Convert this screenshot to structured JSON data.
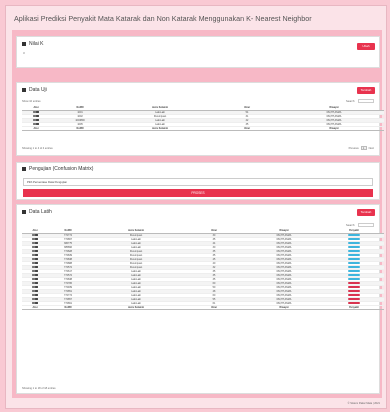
{
  "app": {
    "title": "Aplikasi Prediksi Penyakit Mata Katarak dan Non Katarak Menggunakan K- Nearest Neighbor"
  },
  "nilai_k": {
    "header": "Nilai K",
    "value": "3",
    "button": "Ubah"
  },
  "data_uji": {
    "header": "Data Uji",
    "add_button": "Tambah",
    "show_entries": "Show 10 entries",
    "search_label": "Search:",
    "columns": [
      "Aksi",
      "NoRM",
      "Jenis Kelamin",
      "Umur",
      "Riwayat"
    ],
    "rows": [
      [
        "",
        "1001",
        "Laki-Laki",
        "54",
        "DM,HT,ASMA"
      ],
      [
        "",
        "1002",
        "Perempuan",
        "31",
        "DM,HT,ASMA"
      ],
      [
        "",
        "1003890",
        "Laki-Laki",
        "42",
        "DM,HT,ASMA"
      ],
      [
        "",
        "1005",
        "Laki-Laki",
        "35",
        "DM,HT,ASMA"
      ]
    ],
    "footer_columns": [
      "Aksi",
      "NoRM",
      "Jenis Kelamin",
      "Umur",
      "Riwayat"
    ],
    "info": "Showing 1 to 4 of 4 entries",
    "prev": "Previous",
    "page": "1",
    "next": "Next"
  },
  "pengujian": {
    "header": "Pengujian (Confusion Matrix)",
    "select_value": "Pilih Persentase Data Pengujian",
    "process_button": "PROSES"
  },
  "data_latih": {
    "header": "Data Latih",
    "add_button": "Tambah",
    "search_label": "Search:",
    "columns": [
      "Aksi",
      "NoRM",
      "Jenis Kelamin",
      "Umur",
      "Riwayat",
      "Penyakit"
    ],
    "rows": [
      [
        "",
        "772774",
        "Perempuan",
        "30",
        "DM,HT,ASMA",
        "blue"
      ],
      [
        "",
        "772867",
        "Laki-Laki",
        "35",
        "DM,HT,ASMA",
        "blue"
      ],
      [
        "",
        "386775",
        "Laki-Laki",
        "44",
        "DM,HT,ASMA",
        "blue"
      ],
      [
        "",
        "385896",
        "Laki-Laki",
        "30",
        "DM,HT,ASMA",
        "blue"
      ],
      [
        "",
        "772828",
        "Perempuan",
        "35",
        "DM,HT,ASMA",
        "blue"
      ],
      [
        "",
        "772839",
        "Perempuan",
        "35",
        "DM,HT,ASMA",
        "blue"
      ],
      [
        "",
        "772838",
        "Perempuan",
        "45",
        "DM,HT,ASMA",
        "blue"
      ],
      [
        "",
        "772888",
        "Perempuan",
        "40",
        "DM,HT,ASMA",
        "blue"
      ],
      [
        "",
        "772572",
        "Perempuan",
        "32",
        "DM,HT,ASMA",
        "blue"
      ],
      [
        "",
        "772617",
        "Laki-Laki",
        "35",
        "DM,HT,ASMA",
        "blue"
      ],
      [
        "",
        "772572",
        "Laki-Laki",
        "35",
        "DM,HT,ASMA",
        "blue"
      ],
      [
        "",
        "772838",
        "Laki-Laki",
        "35",
        "DM,HT,ASMA",
        "blue"
      ],
      [
        "",
        "772786",
        "Laki-Laki",
        "60",
        "DM,HT,ASMA",
        "red"
      ],
      [
        "",
        "772939",
        "Laki-Laki",
        "50",
        "DM,HT,ASMA",
        "red"
      ],
      [
        "",
        "772851",
        "Laki-Laki",
        "48",
        "DM,HT,ASMA",
        "red"
      ],
      [
        "",
        "772774",
        "Laki-Laki",
        "60",
        "DM,HT,ASMA",
        "red"
      ],
      [
        "",
        "772857",
        "Laki-Laki",
        "55",
        "DM,HT,ASMA",
        "red"
      ],
      [
        "",
        "772861",
        "Laki-Laki",
        "61",
        "DM,HT,ASMA",
        "red"
      ]
    ],
    "footer_columns": [
      "Aksi",
      "NoRM",
      "Jenis Kelamin",
      "Umur",
      "Riwayat",
      "Penyakit"
    ],
    "info": "Showing 1 to 18 of 18 entries"
  },
  "footer": "© Sistem Pakar Mata | 2021",
  "colors": {
    "accent": "#e8334e",
    "band": "#f7b8c6",
    "bg": "#f9c9d3",
    "katarak": "#d9334f",
    "non_katarak": "#3fb5dd"
  }
}
